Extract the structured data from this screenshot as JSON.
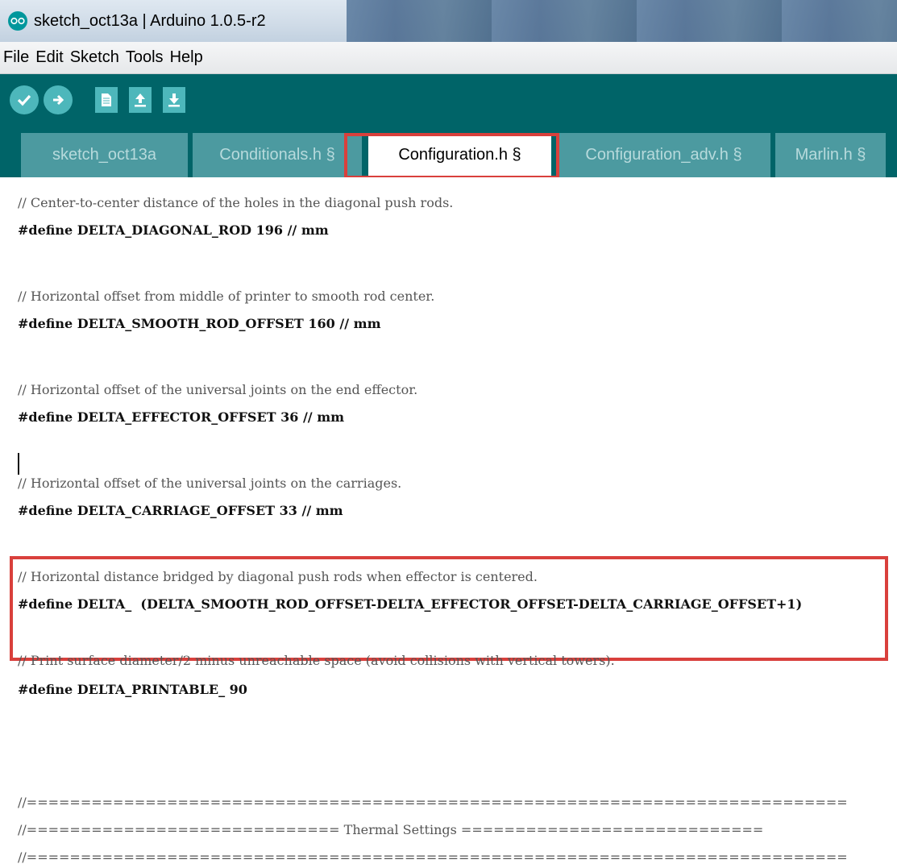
{
  "window": {
    "title": "sketch_oct13a | Arduino 1.0.5-r2"
  },
  "menu": [
    "File",
    "Edit",
    "Sketch",
    "Tools",
    "Help"
  ],
  "toolbar": {
    "buttons": [
      "verify-icon",
      "upload-icon",
      "new-icon",
      "open-icon",
      "save-icon"
    ]
  },
  "tabs": [
    {
      "label": "sketch_oct13a",
      "active": false
    },
    {
      "label": "Conditionals.h §",
      "active": false
    },
    {
      "label": "Configuration.h §",
      "active": true
    },
    {
      "label": "Configuration_adv.h §",
      "active": false
    },
    {
      "label": "Marlin.h §",
      "active": false
    }
  ],
  "code": [
    "// Center-to-center distance of the holes in the diagonal push rods.",
    "#define DELTA_DIAGONAL_ROD 196 // mm",
    "// Horizontal offset from middle of printer to smooth rod center.",
    "#define DELTA_SMOOTH_ROD_OFFSET 160 // mm",
    "// Horizontal offset of the universal joints on the end effector.",
    "#define DELTA_EFFECTOR_OFFSET 36 // mm",
    "// Horizontal offset of the universal joints on the carriages.",
    "#define DELTA_CARRIAGE_OFFSET 33 // mm",
    "// Horizontal distance bridged by diagonal push rods when effector is centered.",
    "#define DELTA_  (DELTA_SMOOTH_ROD_OFFSET-DELTA_EFFECTOR_OFFSET-DELTA_CARRIAGE_OFFSET+1)",
    "// Print surface diameter/2 minus unreachable space (avoid collisions with vertical towers).",
    "#define DELTA_PRINTABLE_ 90",
    "//============================================================================",
    "//============================= Thermal Settings ============================",
    "//============================================================================"
  ],
  "colors": {
    "toolbar": "#006468",
    "tab_inactive": "#4c9aa0",
    "highlight": "#d9403c"
  }
}
